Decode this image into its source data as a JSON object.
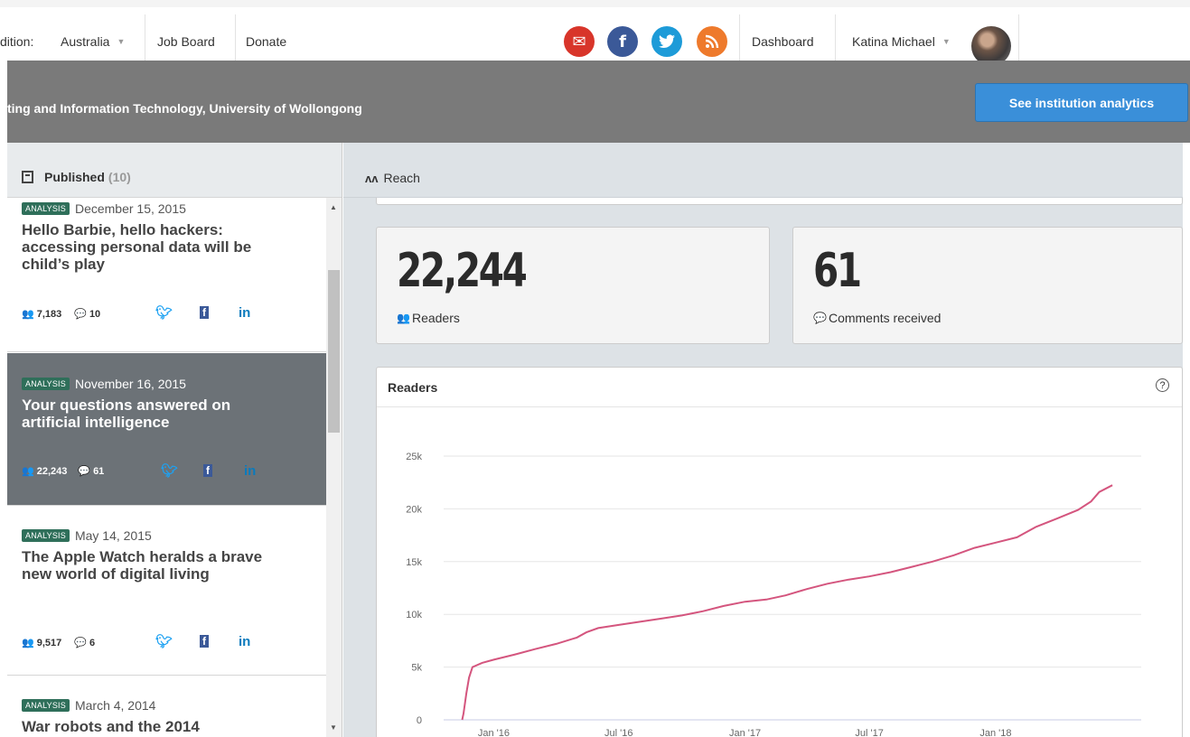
{
  "topbar": {
    "edition_label": "dition:",
    "edition_value": "Australia",
    "job_board": "Job Board",
    "donate": "Donate",
    "dashboard": "Dashboard",
    "user_name": "Katina Michael",
    "icons": [
      "mail-icon",
      "facebook-icon",
      "twitter-icon",
      "rss-icon"
    ],
    "icon_colors": {
      "mail": "#d8352a",
      "facebook": "#3b5998",
      "twitter": "#1d9bd8",
      "rss": "#ee7a2c"
    }
  },
  "header": {
    "title": "ting and Information Technology, University of Wollongong",
    "institution_button": "See institution analytics"
  },
  "sidebar": {
    "heading": "Published",
    "count": "(10)",
    "articles": [
      {
        "tag": "ANALYSIS",
        "date": "December 15, 2015",
        "title": "Hello Barbie, hello hackers: accessing personal data will be child’s play",
        "readers": "7,183",
        "comments": "10",
        "active": false
      },
      {
        "tag": "ANALYSIS",
        "date": "November 16, 2015",
        "title": "Your questions answered on artificial intelligence",
        "readers": "22,243",
        "comments": "61",
        "active": true
      },
      {
        "tag": "ANALYSIS",
        "date": "May 14, 2015",
        "title": "The Apple Watch heralds a brave new world of digital living",
        "readers": "9,517",
        "comments": "6",
        "active": false
      },
      {
        "tag": "ANALYSIS",
        "date": "March 4, 2014",
        "title": "War robots and the 2014",
        "readers": "",
        "comments": "",
        "active": false
      }
    ],
    "social": {
      "twitter": "twitter-icon",
      "facebook": "f",
      "linkedin": "in"
    }
  },
  "reach": {
    "label": "Reach",
    "readers_total": "22,244",
    "readers_label": "Readers",
    "comments_total": "61",
    "comments_label": "Comments received"
  },
  "chart_data": {
    "type": "line",
    "title": "Readers",
    "xlabel": "",
    "ylabel": "",
    "ylim": [
      0,
      25000
    ],
    "yticks": [
      "0",
      "5k",
      "10k",
      "15k",
      "20k",
      "25k"
    ],
    "xticks": [
      "Jan '16",
      "Jul '16",
      "Jan '17",
      "Jul '17",
      "Jan '18"
    ],
    "line_color": "#d4557e",
    "grid": true,
    "x": [
      "2015-11-16",
      "2015-11-18",
      "2015-11-22",
      "2015-11-26",
      "2015-12-01",
      "2015-12-15",
      "2016-01-01",
      "2016-02-01",
      "2016-03-01",
      "2016-04-01",
      "2016-05-01",
      "2016-05-15",
      "2016-06-01",
      "2016-07-01",
      "2016-08-01",
      "2016-09-01",
      "2016-10-01",
      "2016-11-01",
      "2016-12-01",
      "2017-01-01",
      "2017-02-01",
      "2017-03-01",
      "2017-04-01",
      "2017-05-01",
      "2017-06-01",
      "2017-07-01",
      "2017-08-01",
      "2017-09-01",
      "2017-10-01",
      "2017-11-01",
      "2017-12-01",
      "2018-01-01",
      "2018-02-01",
      "2018-03-01",
      "2018-04-01",
      "2018-05-01",
      "2018-05-20",
      "2018-06-01",
      "2018-06-20"
    ],
    "values": [
      0,
      600,
      2500,
      4000,
      5000,
      5400,
      5700,
      6200,
      6700,
      7200,
      7800,
      8300,
      8700,
      9000,
      9300,
      9600,
      9900,
      10300,
      10800,
      11200,
      11400,
      11800,
      12400,
      12900,
      13300,
      13600,
      14000,
      14500,
      15000,
      15600,
      16300,
      16800,
      17300,
      18300,
      19100,
      19900,
      20700,
      21600,
      22244
    ]
  }
}
